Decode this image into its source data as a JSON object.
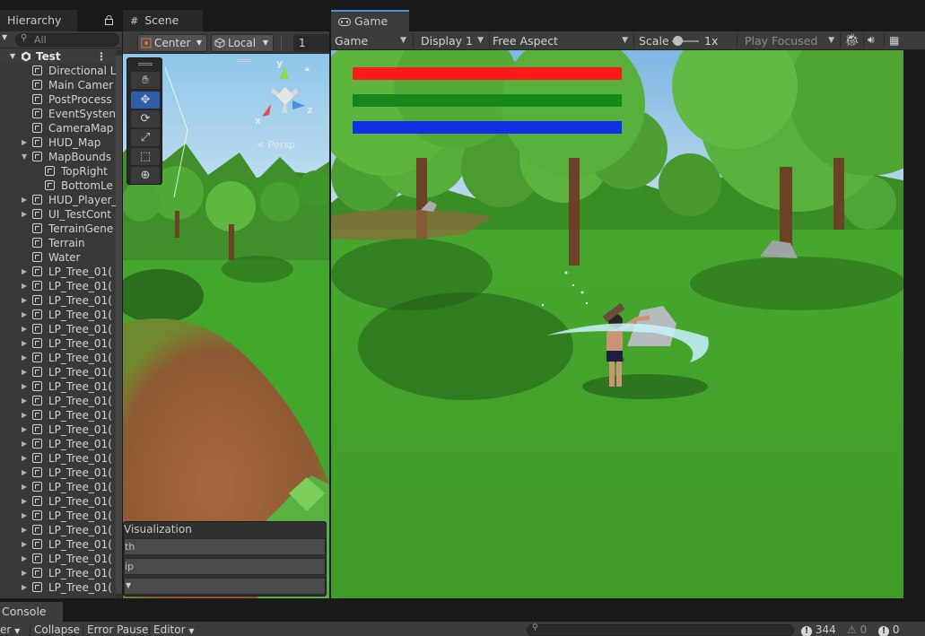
{
  "tabs": {
    "hierarchy": "Hierarchy",
    "scene": "Scene",
    "game": "Game",
    "console": "Console"
  },
  "hierarchy": {
    "search_placeholder": "All",
    "root": "Test",
    "items": [
      {
        "label": "Directional L",
        "indent": 1,
        "arrow": ""
      },
      {
        "label": "Main Camer",
        "indent": 1,
        "arrow": ""
      },
      {
        "label": "PostProcess",
        "indent": 1,
        "arrow": ""
      },
      {
        "label": "EventSysten",
        "indent": 1,
        "arrow": ""
      },
      {
        "label": "CameraMap",
        "indent": 1,
        "arrow": ""
      },
      {
        "label": "HUD_Map",
        "indent": 1,
        "arrow": "▶"
      },
      {
        "label": "MapBounds",
        "indent": 1,
        "arrow": "▼"
      },
      {
        "label": "TopRight",
        "indent": 2,
        "arrow": ""
      },
      {
        "label": "BottomLe",
        "indent": 2,
        "arrow": ""
      },
      {
        "label": "HUD_Player_",
        "indent": 1,
        "arrow": "▶"
      },
      {
        "label": "UI_TestCont",
        "indent": 1,
        "arrow": "▶"
      },
      {
        "label": "TerrainGene",
        "indent": 1,
        "arrow": ""
      },
      {
        "label": "Terrain",
        "indent": 1,
        "arrow": ""
      },
      {
        "label": "Water",
        "indent": 1,
        "arrow": ""
      },
      {
        "label": "LP_Tree_01(",
        "indent": 1,
        "arrow": "▶"
      },
      {
        "label": "LP_Tree_01(",
        "indent": 1,
        "arrow": "▶"
      },
      {
        "label": "LP_Tree_01(",
        "indent": 1,
        "arrow": "▶"
      },
      {
        "label": "LP_Tree_01(",
        "indent": 1,
        "arrow": "▶"
      },
      {
        "label": "LP_Tree_01(",
        "indent": 1,
        "arrow": "▶"
      },
      {
        "label": "LP_Tree_01(",
        "indent": 1,
        "arrow": "▶"
      },
      {
        "label": "LP_Tree_01(",
        "indent": 1,
        "arrow": "▶"
      },
      {
        "label": "LP_Tree_01(",
        "indent": 1,
        "arrow": "▶"
      },
      {
        "label": "LP_Tree_01(",
        "indent": 1,
        "arrow": "▶"
      },
      {
        "label": "LP_Tree_01(",
        "indent": 1,
        "arrow": "▶"
      },
      {
        "label": "LP_Tree_01(",
        "indent": 1,
        "arrow": "▶"
      },
      {
        "label": "LP_Tree_01(",
        "indent": 1,
        "arrow": "▶"
      },
      {
        "label": "LP_Tree_01(",
        "indent": 1,
        "arrow": "▶"
      },
      {
        "label": "LP_Tree_01(",
        "indent": 1,
        "arrow": "▶"
      },
      {
        "label": "LP_Tree_01(",
        "indent": 1,
        "arrow": "▶"
      },
      {
        "label": "LP_Tree_01(",
        "indent": 1,
        "arrow": "▶"
      },
      {
        "label": "LP_Tree_01(",
        "indent": 1,
        "arrow": "▶"
      },
      {
        "label": "LP_Tree_01(",
        "indent": 1,
        "arrow": "▶"
      },
      {
        "label": "LP_Tree_01(",
        "indent": 1,
        "arrow": "▶"
      },
      {
        "label": "LP_Tree_01(",
        "indent": 1,
        "arrow": "▶"
      },
      {
        "label": "LP_Tree_01(",
        "indent": 1,
        "arrow": "▶"
      },
      {
        "label": "LP_Tree_01(",
        "indent": 1,
        "arrow": "▶"
      },
      {
        "label": "LP_Tree_01(",
        "indent": 1,
        "arrow": "▶"
      }
    ]
  },
  "scene": {
    "pivot_label": "Center",
    "space_label": "Local",
    "grid_value": "1",
    "persp_label": "Persp",
    "gizmo_axes": {
      "x": "x",
      "y": "y",
      "z": "z"
    },
    "overlay_title": "Visualization",
    "overlay_rows": [
      "th",
      "ip",
      ""
    ]
  },
  "game": {
    "view_mode": "Game",
    "display": "Display 1",
    "aspect": "Free Aspect",
    "scale_label": "Scale",
    "scale_value": "1x",
    "play_mode": "Play Focused"
  },
  "hud_bars": [
    {
      "name": "red-bar",
      "color": "#ff1a1a",
      "fill": 1.0
    },
    {
      "name": "green-bar",
      "color": "#12891a",
      "fill": 1.0
    },
    {
      "name": "blue-bar",
      "color": "#1030e8",
      "fill": 1.0
    }
  ],
  "console": {
    "clear_label": "er",
    "collapse_label": "Collapse",
    "error_pause_label": "Error Pause",
    "editor_label": "Editor",
    "log_count": "344",
    "warn_count": "0",
    "error_count": "0"
  },
  "colors": {
    "accent": "#4d8fe0",
    "panel": "#383838",
    "toolbar": "#3c3c3c",
    "grass": "#43a62d"
  }
}
